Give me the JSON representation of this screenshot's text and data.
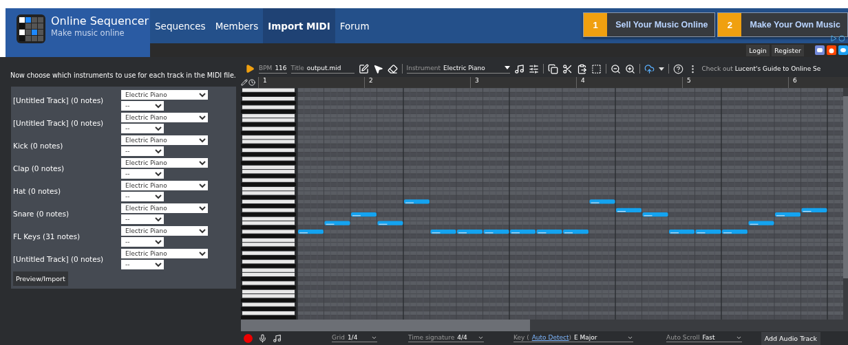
{
  "site": {
    "title": "Online Sequencer",
    "tagline": "Make music online"
  },
  "nav": [
    {
      "label": "Sequences",
      "selected": false
    },
    {
      "label": "Members",
      "selected": false
    },
    {
      "label": "Import MIDI",
      "selected": true
    },
    {
      "label": "Forum",
      "selected": false
    }
  ],
  "promos": [
    {
      "number": "1",
      "label": "Sell Your Music Online"
    },
    {
      "number": "2",
      "label": "Make Your Own Music"
    }
  ],
  "account": [
    "Login",
    "Register"
  ],
  "import": {
    "instructions": "Now choose which instruments to use for each track in the MIDI file.",
    "tracks": [
      {
        "name": "[Untitled Track] (0 notes)",
        "instrument": "Electric Piano",
        "option": "--"
      },
      {
        "name": "[Untitled Track] (0 notes)",
        "instrument": "Electric Piano",
        "option": "--"
      },
      {
        "name": "Kick (0 notes)",
        "instrument": "Electric Piano",
        "option": "--"
      },
      {
        "name": "Clap (0 notes)",
        "instrument": "Electric Piano",
        "option": "--"
      },
      {
        "name": "Hat (0 notes)",
        "instrument": "Electric Piano",
        "option": "--"
      },
      {
        "name": "Snare (0 notes)",
        "instrument": "Electric Piano",
        "option": "--"
      },
      {
        "name": "FL Keys (31 notes)",
        "instrument": "Electric Piano",
        "option": "--"
      },
      {
        "name": "[Untitled Track] (0 notes)",
        "instrument": "Electric Piano",
        "option": "--"
      }
    ],
    "button": "Preview/Import"
  },
  "toolbar": {
    "bpm_label": "BPM",
    "bpm": "116",
    "title_label": "Title",
    "title": "output.mid",
    "instrument_label": "Instrument",
    "instrument": "Electric Piano",
    "guide_prefix": "Check out",
    "guide": "Lucent's Guide to Online Se"
  },
  "ruler": [
    "1",
    "2",
    "3",
    "4",
    "5",
    "6"
  ],
  "bottom": {
    "grid_label": "Grid",
    "grid": "1/4",
    "time_label": "Time signature",
    "time": "4/4",
    "key_prefix": "Key (",
    "key_link": "Auto Detect",
    "key_suffix": ")",
    "key": "E Major",
    "scroll_label": "Auto Scroll",
    "scroll": "Fast",
    "add_button": "Add Audio Track"
  }
}
